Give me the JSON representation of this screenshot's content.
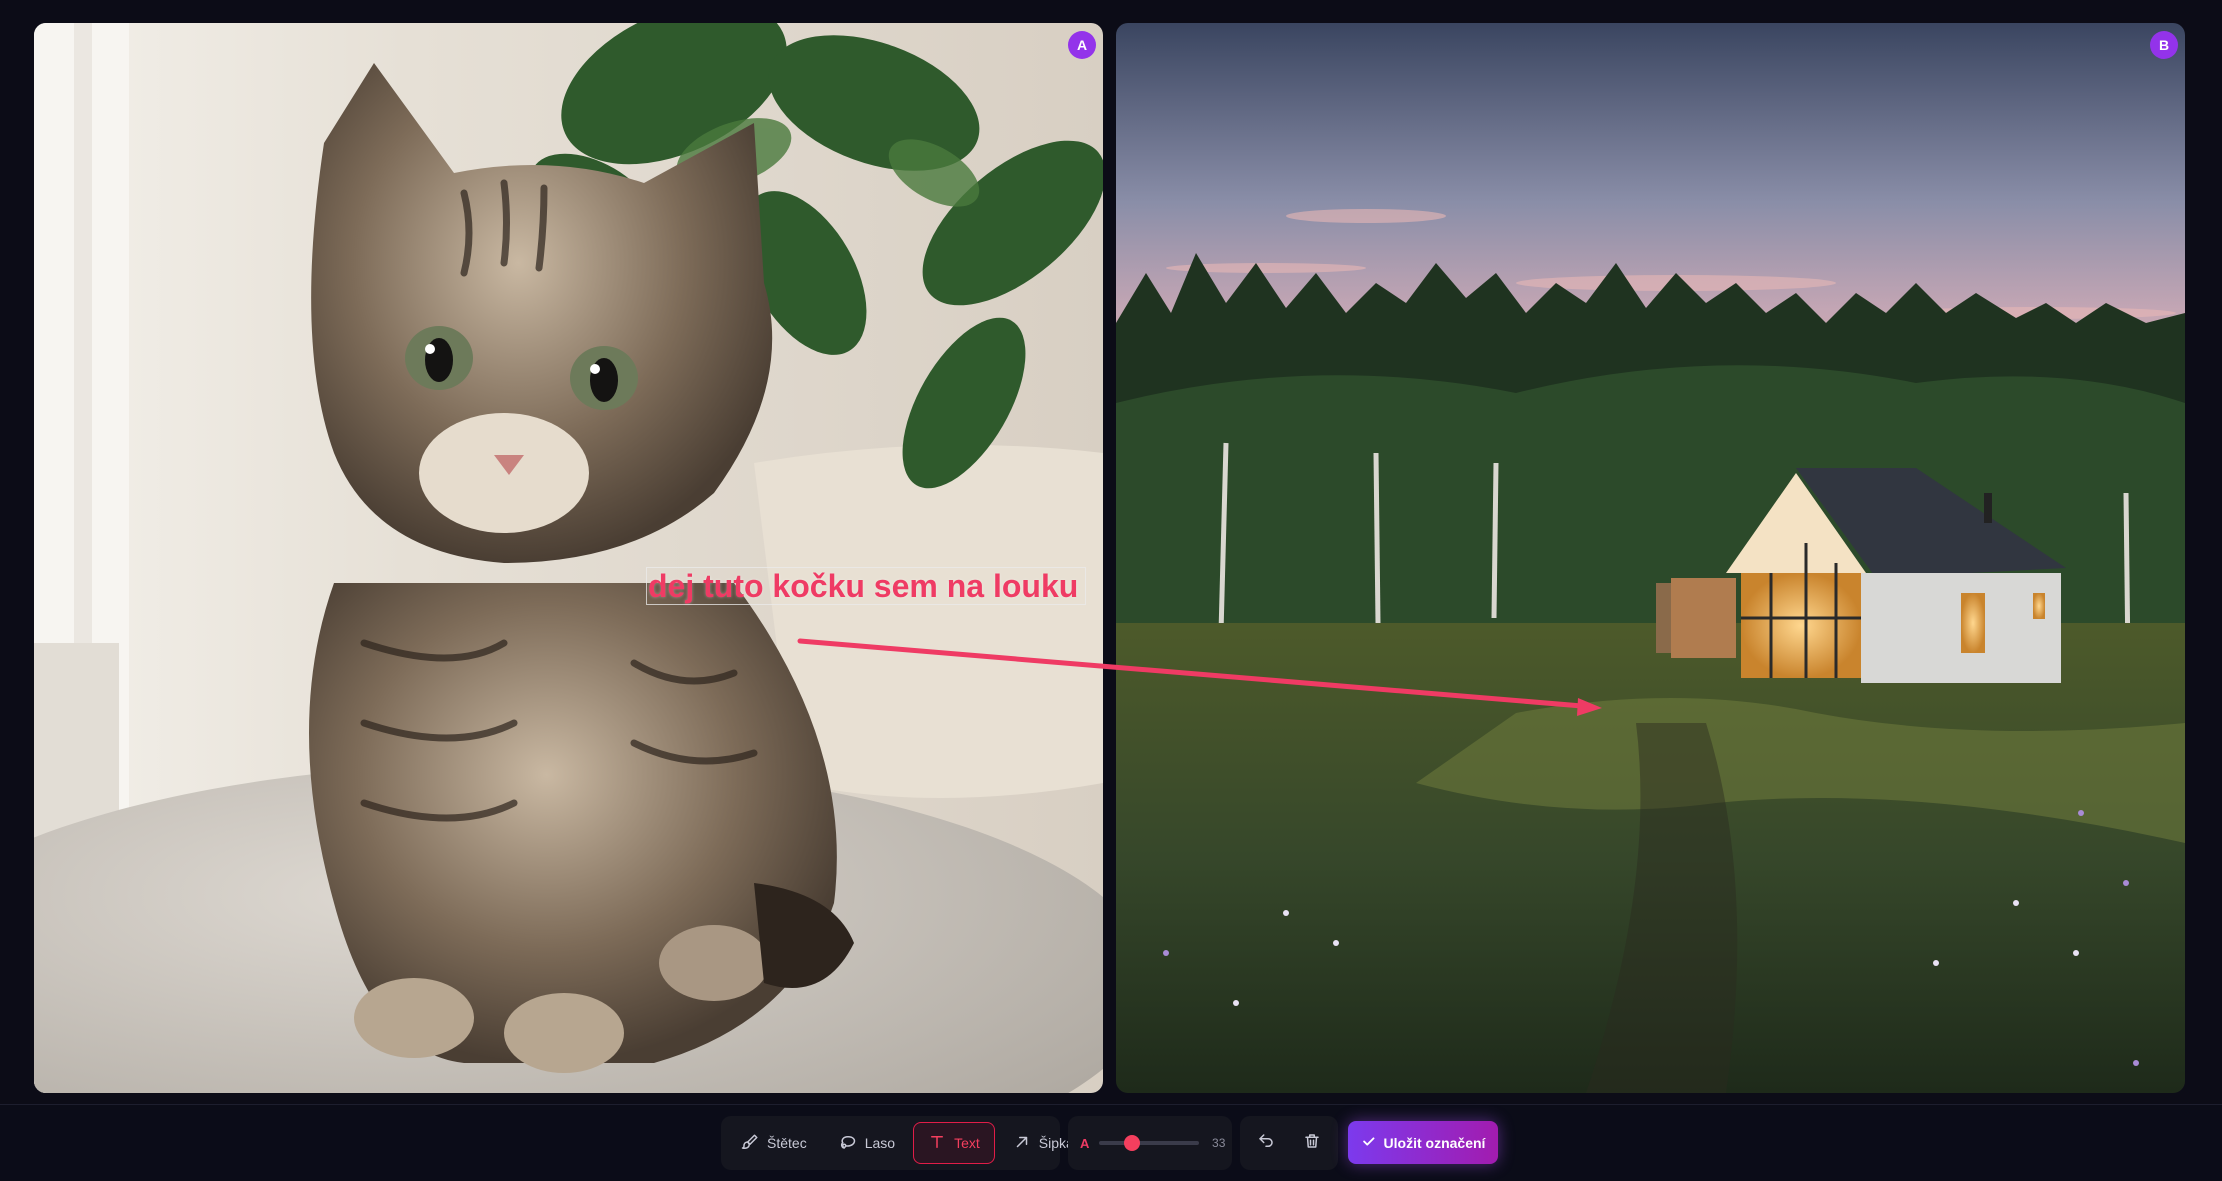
{
  "panels": {
    "a": {
      "badge": "A",
      "photo": "tabby kitten sitting on a cushion beside a potted plant"
    },
    "b": {
      "badge": "B",
      "photo": "modern cabin in a meadow at dusk with forest behind"
    }
  },
  "annotation": {
    "text": "dej tuto kočku sem na louku",
    "color": "#ef3b64"
  },
  "toolbar": {
    "tools": [
      {
        "label": "Štětec",
        "icon": "brush-icon",
        "active": false
      },
      {
        "label": "Laso",
        "icon": "lasso-icon",
        "active": false
      },
      {
        "label": "Text",
        "icon": "text-icon",
        "active": true
      },
      {
        "label": "Šipka",
        "icon": "arrow-icon",
        "active": false
      }
    ],
    "size_label": "A",
    "size_value": "33",
    "size_level": 0.33,
    "save_label": "Uložit označení"
  },
  "colors": {
    "accent": "#f43f5e",
    "badge": "#9333ea",
    "background": "#0c0c17"
  }
}
